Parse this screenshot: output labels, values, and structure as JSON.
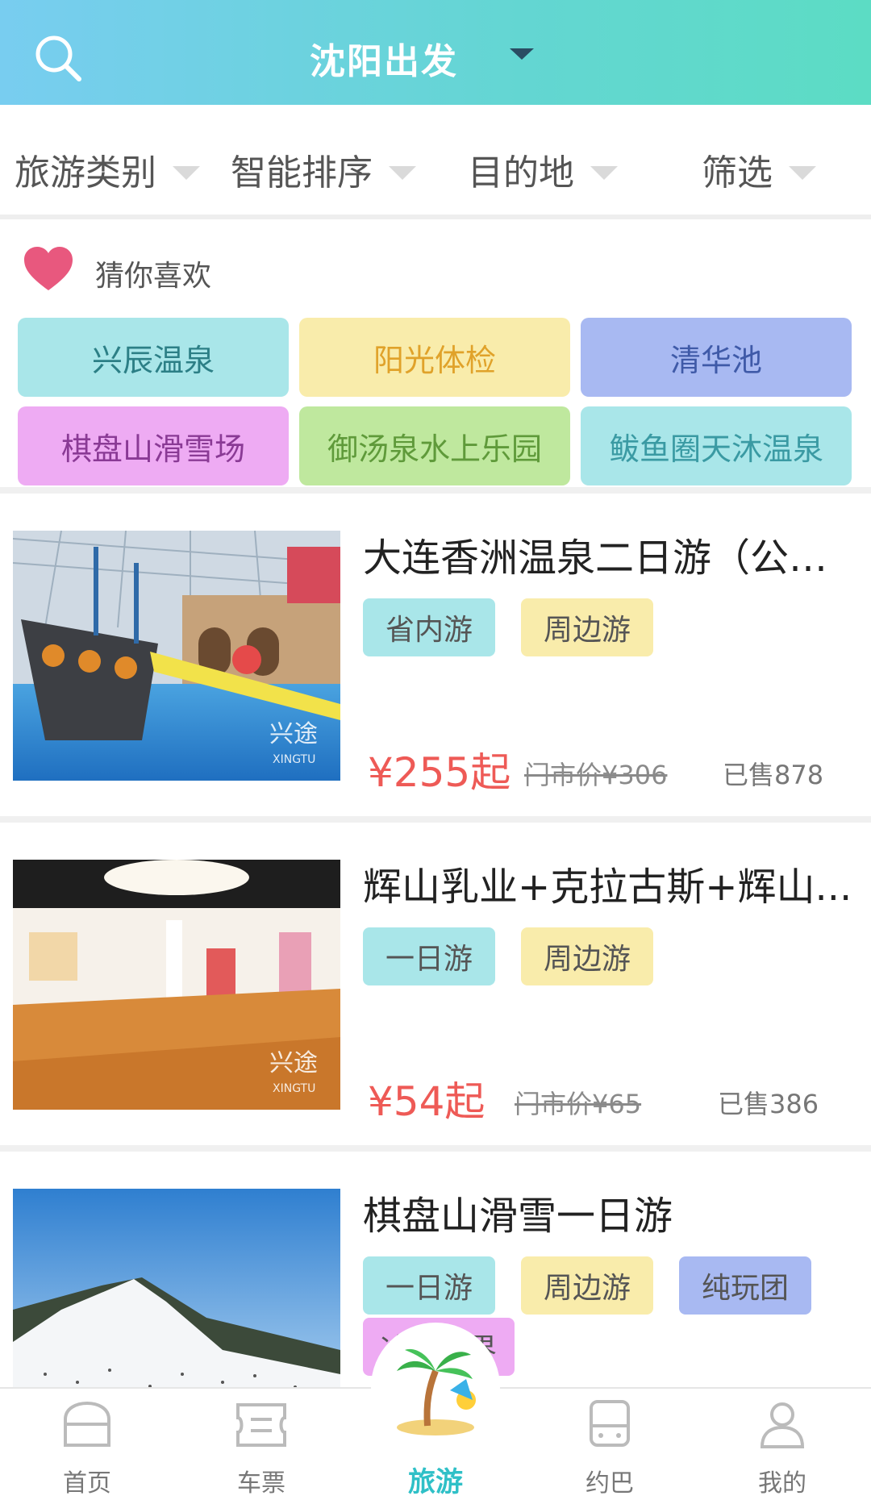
{
  "header": {
    "city": "沈阳出发"
  },
  "filters": [
    {
      "label": "旅游类别"
    },
    {
      "label": "智能排序"
    },
    {
      "label": "目的地"
    },
    {
      "label": "筛选"
    }
  ],
  "guess": {
    "title": "猜你喜欢",
    "tags": [
      {
        "label": "兴辰温泉",
        "bg": "#a9e6e9",
        "fg": "#2c7f86"
      },
      {
        "label": "阳光体检",
        "bg": "#f9ecab",
        "fg": "#e0a22a"
      },
      {
        "label": "清华池",
        "bg": "#a8b9f2",
        "fg": "#3f5aa8"
      },
      {
        "label": "棋盘山滑雪场",
        "bg": "#eeabf3",
        "fg": "#8a3a95"
      },
      {
        "label": "御汤泉水上乐园",
        "bg": "#bfe89e",
        "fg": "#5f9a3a"
      },
      {
        "label": "鲅鱼圈天沐温泉",
        "bg": "#a9e6e9",
        "fg": "#3a9aa3"
      }
    ]
  },
  "products": [
    {
      "name": "大连香洲温泉二日游（公寓...",
      "chips": [
        "省内游",
        "周边游"
      ],
      "price": "¥255起",
      "market_price": "门市价¥306",
      "sold": "已售878",
      "watermark": "兴途",
      "watermark_en": "XINGTU"
    },
    {
      "name": "辉山乳业+克拉古斯+辉山...",
      "chips": [
        "一日游",
        "周边游"
      ],
      "price": "¥54起",
      "market_price": "门市价¥65",
      "sold": "已售386",
      "watermark": "兴途",
      "watermark_en": "XINGTU"
    },
    {
      "name": "棋盘山滑雪一日游",
      "chips": [
        "一日游",
        "周边游",
        "纯玩团",
        "冰雪世界"
      ]
    }
  ],
  "bottom_nav": [
    {
      "label": "首页",
      "icon": "home-icon"
    },
    {
      "label": "车票",
      "icon": "ticket-icon"
    },
    {
      "label": "旅游",
      "icon": "palm-tree-icon",
      "active": true
    },
    {
      "label": "约巴",
      "icon": "bus-icon"
    },
    {
      "label": "我的",
      "icon": "user-icon"
    }
  ],
  "colors": {
    "header_gradient_start": "#78cdf0",
    "header_gradient_end": "#5cdcc4",
    "price": "#ee5a56",
    "active_tab": "#2fc0c7",
    "heart": "#e8587e"
  }
}
